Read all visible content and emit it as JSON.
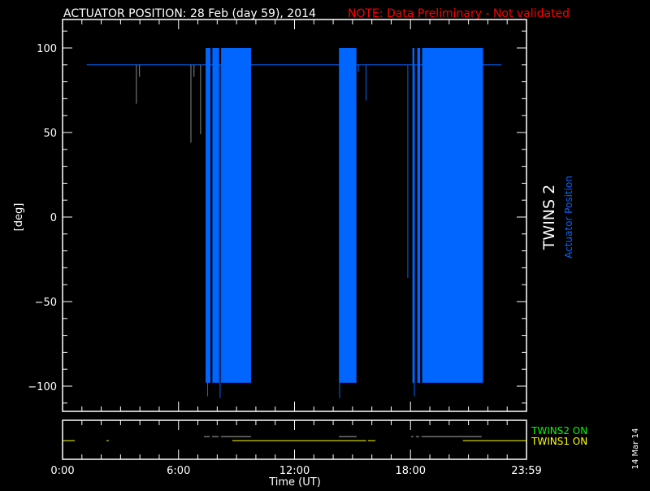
{
  "title": "ACTUATOR POSITION: 28 Feb (day  59), 2014",
  "note": "NOTE: Data Preliminary - Not validated",
  "side_title": "TWINS 2",
  "side_subtitle": "Actuator Position",
  "date_stamp": "14 Mar 14",
  "colors": {
    "series": "#0066ff",
    "twins2": "#00ff00",
    "twins1": "#ffff00",
    "note": "#ff0000",
    "axis": "#ffffff"
  },
  "chart_data": [
    {
      "type": "line",
      "title": "ACTUATOR POSITION",
      "xlabel": "Time (UT)",
      "ylabel": "[deg]",
      "xlim": [
        0,
        24
      ],
      "ylim": [
        -115,
        115
      ],
      "yticks": [
        100,
        50,
        0,
        -50,
        -100
      ],
      "ytick_labels": [
        "100",
        "50",
        "0",
        "−50",
        "−100"
      ],
      "baseline": {
        "start": 1.25,
        "end": 22.7,
        "value": 90
      },
      "oscillation_blocks": [
        {
          "start": 7.4,
          "end": 7.65,
          "min": -98,
          "max": 100
        },
        {
          "start": 7.75,
          "end": 8.1,
          "min": -98,
          "max": 100
        },
        {
          "start": 8.2,
          "end": 9.75,
          "min": -98,
          "max": 100
        },
        {
          "start": 14.3,
          "end": 15.2,
          "min": -98,
          "max": 100
        },
        {
          "start": 18.1,
          "end": 18.2,
          "min": -98,
          "max": 100
        },
        {
          "start": 18.35,
          "end": 18.5,
          "min": -98,
          "max": 100
        },
        {
          "start": 18.6,
          "end": 21.75,
          "min": -98,
          "max": 100
        }
      ],
      "spikes": [
        {
          "t": 3.82,
          "v": 67
        },
        {
          "t": 3.98,
          "v": 83
        },
        {
          "t": 6.64,
          "v": 44
        },
        {
          "t": 6.8,
          "v": 83
        },
        {
          "t": 7.14,
          "v": 49
        },
        {
          "t": 7.5,
          "v": -106
        },
        {
          "t": 8.15,
          "v": -107
        },
        {
          "t": 14.33,
          "v": -107
        },
        {
          "t": 15.3,
          "v": 86
        },
        {
          "t": 15.7,
          "v": 69
        },
        {
          "t": 17.86,
          "v": -36
        },
        {
          "t": 18.2,
          "v": -106
        }
      ]
    },
    {
      "type": "timeline",
      "xtick_labels": [
        "0:00",
        "6:00",
        "12:00",
        "18:00",
        "23:59"
      ],
      "xtick_values": [
        0,
        6,
        12,
        18,
        24
      ],
      "series": [
        {
          "name": "TWINS2 ON",
          "segments": [
            [
              7.31,
              7.61
            ],
            [
              7.73,
              8.07
            ],
            [
              8.19,
              9.75
            ],
            [
              14.29,
              15.21
            ],
            [
              18.03,
              18.15
            ],
            [
              18.28,
              18.45
            ],
            [
              18.57,
              21.68
            ]
          ]
        },
        {
          "name": "TWINS1 ON",
          "segments": [
            [
              0,
              0.63
            ],
            [
              2.27,
              2.39
            ],
            [
              8.78,
              15.71
            ],
            [
              15.8,
              16.18
            ],
            [
              20.71,
              24
            ]
          ]
        }
      ]
    }
  ]
}
